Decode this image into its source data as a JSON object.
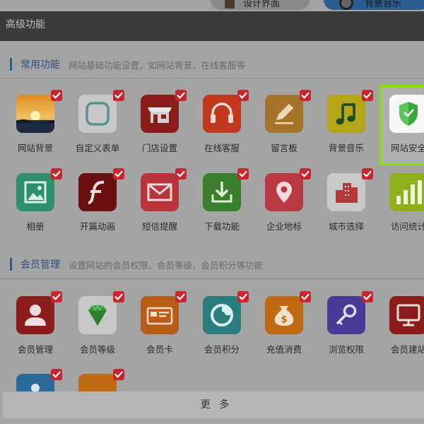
{
  "toolbar": {
    "left_button": "设计界面",
    "right_button": "背景音乐"
  },
  "dialog": {
    "title": "高级功能",
    "more_label": "更 多"
  },
  "sections": [
    {
      "title": "常用功能",
      "desc": "网站基础功能设置，如网站背景、在线客服等"
    },
    {
      "title": "会员管理",
      "desc": "设置网站的会员权限、会员等级、会员积分等功能"
    }
  ],
  "items": [
    {
      "label": "网站背景",
      "icon": "landscape-icon",
      "checked": true
    },
    {
      "label": "自定义表单",
      "icon": "form-icon",
      "checked": true
    },
    {
      "label": "门店设置",
      "icon": "store-icon",
      "checked": true
    },
    {
      "label": "在线客服",
      "icon": "headset-icon",
      "checked": true
    },
    {
      "label": "留言板",
      "icon": "pencil-icon",
      "checked": true
    },
    {
      "label": "背景音乐",
      "icon": "music-note-icon",
      "checked": true
    },
    {
      "label": "网站安全",
      "icon": "shield-icon",
      "checked": true,
      "selected": true
    },
    {
      "label": "相册",
      "icon": "photo-album-icon",
      "checked": true
    },
    {
      "label": "开篇动画",
      "icon": "flash-icon",
      "checked": true
    },
    {
      "label": "短信提醒",
      "icon": "envelope-icon",
      "checked": true
    },
    {
      "label": "下载功能",
      "icon": "download-icon",
      "checked": true
    },
    {
      "label": "企业地标",
      "icon": "map-pin-icon",
      "checked": true
    },
    {
      "label": "城市选择",
      "icon": "city-icon",
      "checked": true
    },
    {
      "label": "访问统计",
      "icon": "bar-stats-icon",
      "checked": false
    },
    {
      "label": "会员管理",
      "icon": "user-icon",
      "checked": true
    },
    {
      "label": "会员等级",
      "icon": "diamond-icon",
      "checked": true
    },
    {
      "label": "会员卡",
      "icon": "card-icon",
      "checked": true
    },
    {
      "label": "会员积分",
      "icon": "points-icon",
      "checked": true
    },
    {
      "label": "充值消费",
      "icon": "money-bag-icon",
      "checked": true
    },
    {
      "label": "浏览权限",
      "icon": "key-icon",
      "checked": true
    },
    {
      "label": "会员建站",
      "icon": "monitor-icon",
      "checked": false
    },
    {
      "label": "",
      "icon": "partial-blue-icon",
      "checked": true
    },
    {
      "label": "",
      "icon": "partial-orange-icon",
      "checked": true
    }
  ],
  "colors": {
    "accent": "#2e5f8c",
    "check": "#c8262e",
    "selection": "#86e000"
  }
}
